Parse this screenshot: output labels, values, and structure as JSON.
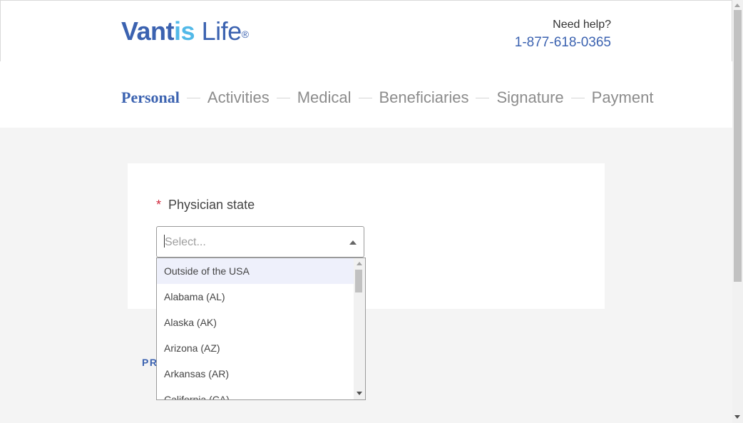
{
  "brand": {
    "logo_part1": "Vant",
    "logo_part2": "is",
    "logo_part3": " Life",
    "logo_reg": "®",
    "colors": {
      "primary": "#3b62b0",
      "accent": "#52b9e8",
      "required": "#d0283c"
    }
  },
  "help": {
    "label": "Need help?",
    "phone": "1-877-618-0365"
  },
  "steps": [
    {
      "label": "Personal",
      "active": true
    },
    {
      "label": "Activities",
      "active": false
    },
    {
      "label": "Medical",
      "active": false
    },
    {
      "label": "Beneficiaries",
      "active": false
    },
    {
      "label": "Signature",
      "active": false
    },
    {
      "label": "Payment",
      "active": false
    }
  ],
  "form": {
    "required_mark": "*",
    "field_label": "Physician state",
    "placeholder": "Select...",
    "arrow_icon": "caret-up-icon",
    "options": [
      {
        "label": "Outside of the USA",
        "highlighted": true
      },
      {
        "label": "Alabama (AL)",
        "highlighted": false
      },
      {
        "label": "Alaska (AK)",
        "highlighted": false
      },
      {
        "label": "Arizona (AZ)",
        "highlighted": false
      },
      {
        "label": "Arkansas (AR)",
        "highlighted": false
      },
      {
        "label": "California (CA)",
        "highlighted": false
      }
    ]
  },
  "nav": {
    "prev_label": "PR"
  }
}
